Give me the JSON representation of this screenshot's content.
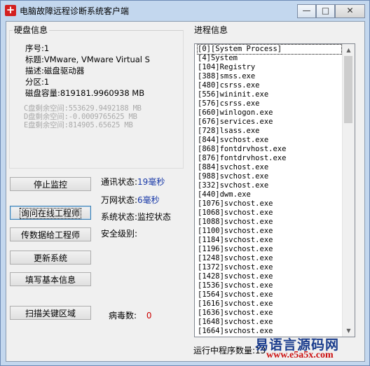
{
  "window": {
    "title": "电脑故障远程诊断系统客户端",
    "icon": "red-plus-app-icon",
    "controls": {
      "minimize": "—",
      "maximize": "□",
      "close": "✕"
    },
    "colors": {
      "frame": "#c3d7ee",
      "client": "#f0f0f0"
    }
  },
  "disk": {
    "legend": "硬盘信息",
    "lines": [
      "序号:1",
      "标题:VMware, VMware Virtual S",
      "描述:磁盘驱动器",
      "分区:1",
      "磁盘容量:819181.9960938 MB"
    ],
    "free_lines": [
      "C盘剩余空间:553629.9492188 MB",
      "D盘剩余空间:-0.0009765625 MB",
      "E盘剩余空间:814905.65625 MB"
    ]
  },
  "buttons": {
    "stop_monitor": "停止监控",
    "ask_engineer": "询问在线工程师",
    "send_data": "传数据给工程师",
    "update_system": "更新系统",
    "fill_info": "填写基本信息",
    "scan_key_area": "扫描关键区域"
  },
  "status": {
    "comm_label": "通讯状态:",
    "comm_value": "19毫秒",
    "net_label": "万网状态:",
    "net_value": "6毫秒",
    "system_label": "系统状态:",
    "system_value": "监控状态",
    "security_label": "安全级别:",
    "virus_label": "病毒数:",
    "virus_value": "0",
    "virus_color": "#cc0000",
    "value_color": "#1a3aa8"
  },
  "process": {
    "legend": "进程信息",
    "items": [
      "[0][System Process]",
      "[4]System",
      "[104]Registry",
      "[388]smss.exe",
      "[480]csrss.exe",
      "[556]wininit.exe",
      "[576]csrss.exe",
      "[660]winlogon.exe",
      "[676]services.exe",
      "[728]lsass.exe",
      "[844]svchost.exe",
      "[868]fontdrvhost.exe",
      "[876]fontdrvhost.exe",
      "[884]svchost.exe",
      "[988]svchost.exe",
      "[332]svchost.exe",
      "[440]dwm.exe",
      "[1076]svchost.exe",
      "[1068]svchost.exe",
      "[1088]svchost.exe",
      "[1100]svchost.exe",
      "[1184]svchost.exe",
      "[1196]svchost.exe",
      "[1248]svchost.exe",
      "[1372]svchost.exe",
      "[1428]svchost.exe",
      "[1536]svchost.exe",
      "[1564]svchost.exe",
      "[1616]svchost.exe",
      "[1636]svchost.exe",
      "[1648]svchost.exe",
      "[1664]svchost.exe"
    ],
    "count_label": "运行中程序数量:",
    "count_value": "13"
  },
  "watermark": {
    "main": "易语言源码网",
    "url": "www.e5a5x.com"
  }
}
